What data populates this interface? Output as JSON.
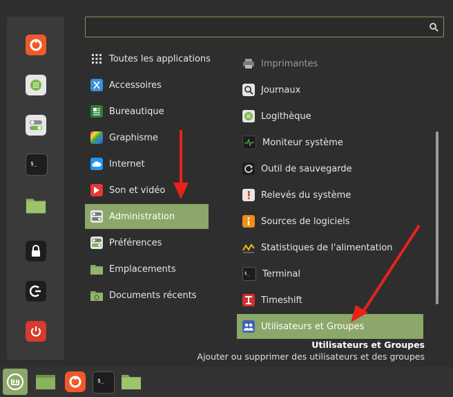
{
  "search": {
    "value": "",
    "placeholder": ""
  },
  "favorites": [
    {
      "icon": "firefox-icon",
      "color": "#f5641f"
    },
    {
      "icon": "software-manager-icon",
      "color": "#e8e8e8"
    },
    {
      "icon": "settings-toggle-icon",
      "color": "#e8e8e8"
    },
    {
      "icon": "terminal-icon",
      "color": "#1e1e1e"
    },
    {
      "icon": "folder-icon",
      "color": "#8bb35e"
    },
    {
      "icon": "lock-icon",
      "color": "#1e1e1e"
    },
    {
      "icon": "logout-icon",
      "color": "#1e1e1e"
    },
    {
      "icon": "power-icon",
      "color": "#d83a2e"
    }
  ],
  "categories": [
    {
      "label": "Toutes les applications",
      "icon": "grid-icon"
    },
    {
      "label": "Accessoires",
      "icon": "accessories-icon"
    },
    {
      "label": "Bureautique",
      "icon": "office-icon"
    },
    {
      "label": "Graphisme",
      "icon": "graphics-icon"
    },
    {
      "label": "Internet",
      "icon": "internet-icon"
    },
    {
      "label": "Son et vidéo",
      "icon": "multimedia-icon"
    },
    {
      "label": "Administration",
      "icon": "administration-icon",
      "active": true
    },
    {
      "label": "Préférences",
      "icon": "preferences-icon"
    },
    {
      "label": "Emplacements",
      "icon": "places-folder-icon"
    },
    {
      "label": "Documents récents",
      "icon": "recent-documents-icon"
    }
  ],
  "apps": [
    {
      "label": "Imprimantes",
      "icon": "printer-icon",
      "dimmed": true
    },
    {
      "label": "Journaux",
      "icon": "logs-icon"
    },
    {
      "label": "Logithèque",
      "icon": "software-manager-icon"
    },
    {
      "label": "Moniteur système",
      "icon": "system-monitor-icon"
    },
    {
      "label": "Outil de sauvegarde",
      "icon": "backup-icon"
    },
    {
      "label": "Relevés du système",
      "icon": "system-reports-icon"
    },
    {
      "label": "Sources de logiciels",
      "icon": "software-sources-icon"
    },
    {
      "label": "Statistiques de l'alimentation",
      "icon": "power-statistics-icon"
    },
    {
      "label": "Terminal",
      "icon": "terminal-icon"
    },
    {
      "label": "Timeshift",
      "icon": "timeshift-icon"
    },
    {
      "label": "Utilisateurs et Groupes",
      "icon": "users-groups-icon",
      "active": true
    }
  ],
  "description": {
    "title": "Utilisateurs et Groupes",
    "text": "Ajouter ou supprimer des utilisateurs et des groupes"
  },
  "taskbar": [
    {
      "icon": "mint-menu-icon"
    },
    {
      "icon": "show-desktop-icon"
    },
    {
      "icon": "firefox-icon"
    },
    {
      "icon": "terminal-icon"
    },
    {
      "icon": "files-icon"
    }
  ],
  "colors": {
    "accent": "#8ba76a",
    "arrow": "#e8221b",
    "background": "#2e2e2e"
  }
}
